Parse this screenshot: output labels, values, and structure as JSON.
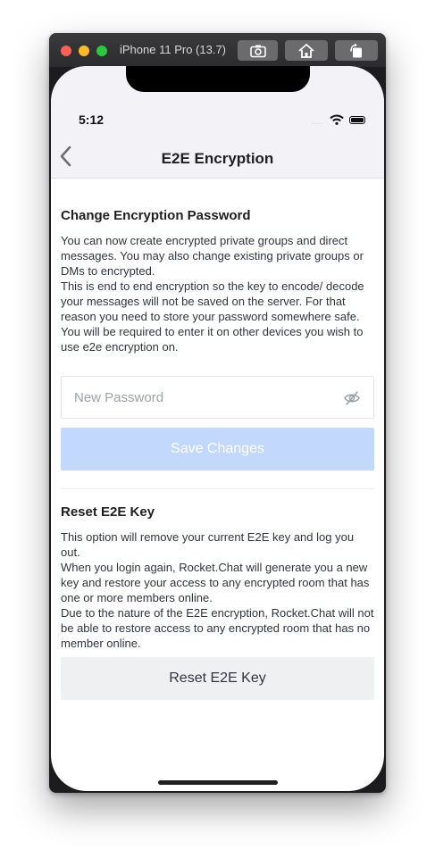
{
  "simulator": {
    "title": "iPhone 11 Pro (13.7)",
    "buttons": [
      "screenshot-icon",
      "home-icon",
      "rotate-icon"
    ]
  },
  "statusbar": {
    "time": "5:12",
    "signal_dots": ".....",
    "icons": [
      "wifi-icon",
      "battery-icon"
    ]
  },
  "navbar": {
    "title": "E2E Encryption",
    "back_icon": "chevron-left-icon"
  },
  "change_password": {
    "title": "Change Encryption Password",
    "description": [
      "You can now create encrypted private groups and direct messages. You may also change existing private groups or DMs to encrypted.",
      "This is end to end encryption so the key to encode/ decode your messages will not be saved on the server. For that reason you need to store your password somewhere safe. You will be required to enter it on other devices you wish to use e2e encryption on."
    ],
    "password_placeholder": "New Password",
    "password_value": "",
    "eye_icon": "eye-off-icon",
    "save_label": "Save Changes"
  },
  "reset_key": {
    "title": "Reset E2E Key",
    "description": [
      "This option will remove your current E2E key and log you out.",
      "When you login again, Rocket.Chat will generate you a new key and restore your access to any encrypted room that has one or more members online.",
      "Due to the nature of the E2E encryption, Rocket.Chat will not be able to restore access to any encrypted room that has no member online."
    ],
    "button_label": "Reset E2E Key"
  },
  "colors": {
    "save_button_disabled": "#c2d8fc",
    "reset_button_bg": "#eff0f2",
    "navbar_bg": "#f2f2f7",
    "text": "#2f343d"
  }
}
